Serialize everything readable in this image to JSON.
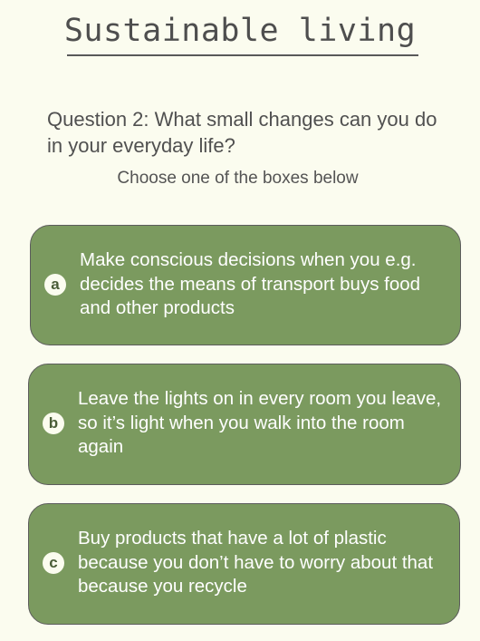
{
  "page": {
    "title": "Sustainable living",
    "question": "Question 2: What small changes can you do in your everyday life?",
    "instruction": "Choose one of the boxes below"
  },
  "options": [
    {
      "letter": "a",
      "text": "Make conscious decisions when you e.g. decides the means of transport buys food and other products"
    },
    {
      "letter": "b",
      "text": "Leave the lights on in every room you leave, so it’s light when you walk into the room again"
    },
    {
      "letter": "c",
      "text": "Buy products that have a lot of plastic because you don’t have to worry about that because you recycle"
    }
  ],
  "colors": {
    "background": "#fbfcef",
    "option_fill": "#7b9a5f",
    "option_border": "#5c5c5c",
    "text": "#4f4f4f"
  }
}
